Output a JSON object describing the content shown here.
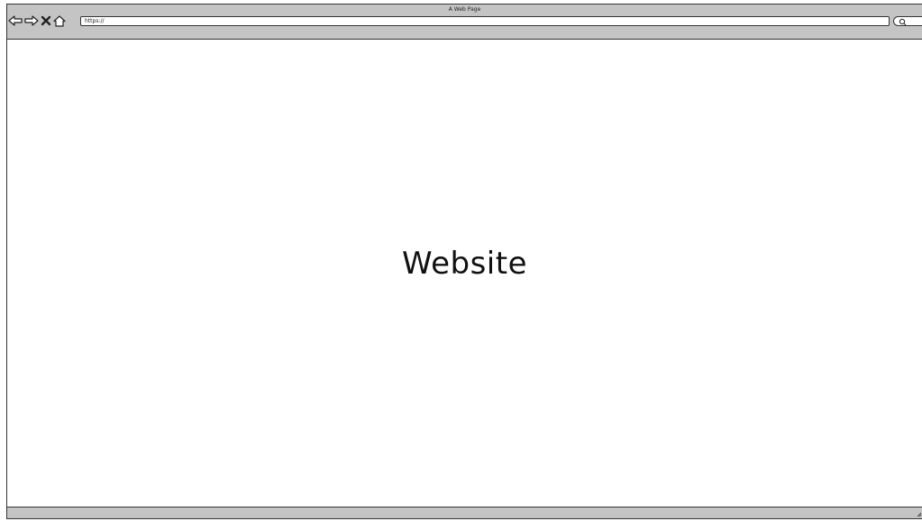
{
  "window": {
    "title": "A Web Page"
  },
  "toolbar": {
    "buttons": [
      {
        "name": "back",
        "icon": "arrow-left-icon"
      },
      {
        "name": "forward",
        "icon": "arrow-right-icon"
      },
      {
        "name": "stop",
        "icon": "close-icon"
      },
      {
        "name": "home",
        "icon": "home-icon"
      }
    ],
    "address": "https://",
    "search_icon": "search-icon"
  },
  "page": {
    "headline": "Website"
  },
  "colors": {
    "chrome": "#c4c4c4",
    "border": "#333333",
    "background": "#ffffff",
    "text": "#111111"
  }
}
